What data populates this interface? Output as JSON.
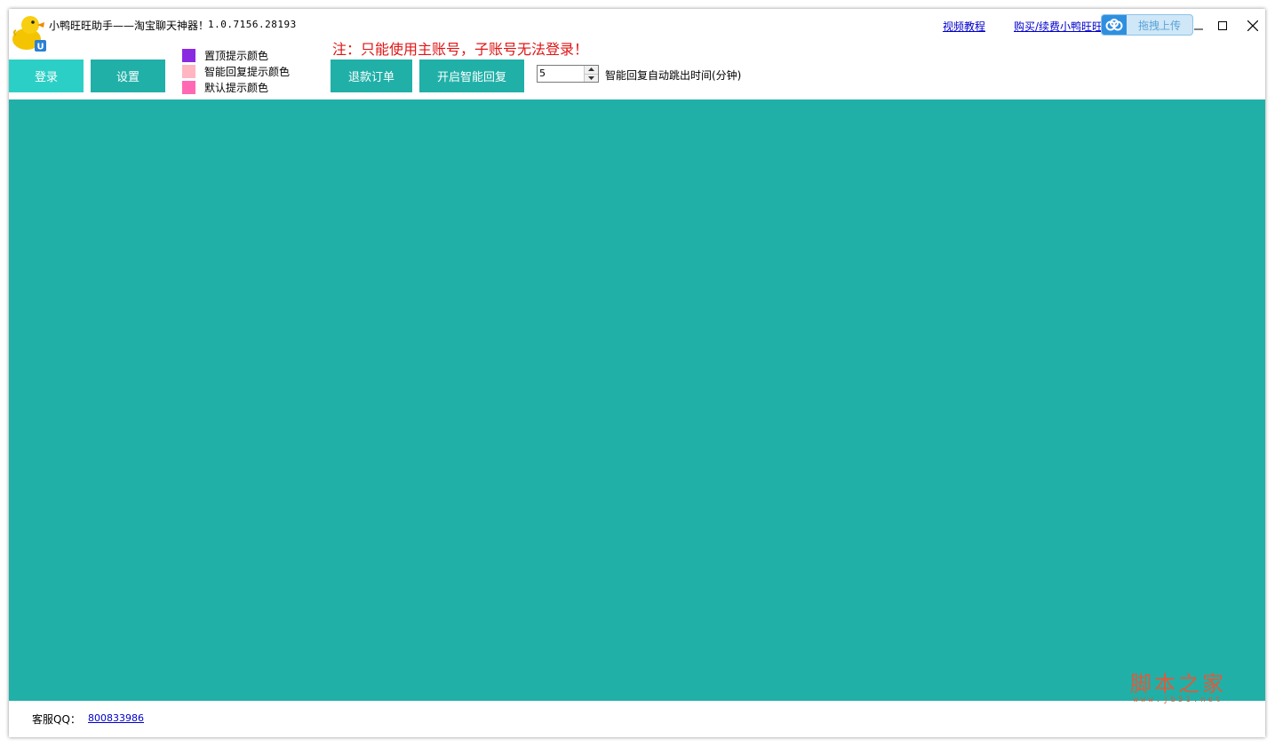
{
  "app": {
    "title": "小鸭旺旺助手——淘宝聊天神器！",
    "version": "1.0.7156.28193"
  },
  "header_links": {
    "video_tutorial": "视频教程",
    "buy_renew": "购买/续费小鸭旺旺"
  },
  "cloud_upload": {
    "label": "拖拽上传"
  },
  "toolbar": {
    "login_label": "登录",
    "settings_label": "设置",
    "refund_label": "退款订单",
    "smart_reply_label": "开启智能回复"
  },
  "legend": [
    {
      "label": "置顶提示颜色",
      "color": "#8a2be2"
    },
    {
      "label": "智能回复提示颜色",
      "color": "#ffb6c1"
    },
    {
      "label": "默认提示颜色",
      "color": "#ff69b4"
    }
  ],
  "notice": "注：只能使用主账号，子账号无法登录！",
  "auto_jump": {
    "value": "5",
    "label": "智能回复自动跳出时间(分钟)"
  },
  "footer": {
    "qq_label": "客服QQ：",
    "qq_number": "800833986"
  },
  "watermark": {
    "text": "脚本之家",
    "url": "www.jb51.net"
  },
  "colors": {
    "main_bg": "#20b0a8",
    "login_button": "#2bcfc6",
    "notice_red": "#e01515"
  }
}
